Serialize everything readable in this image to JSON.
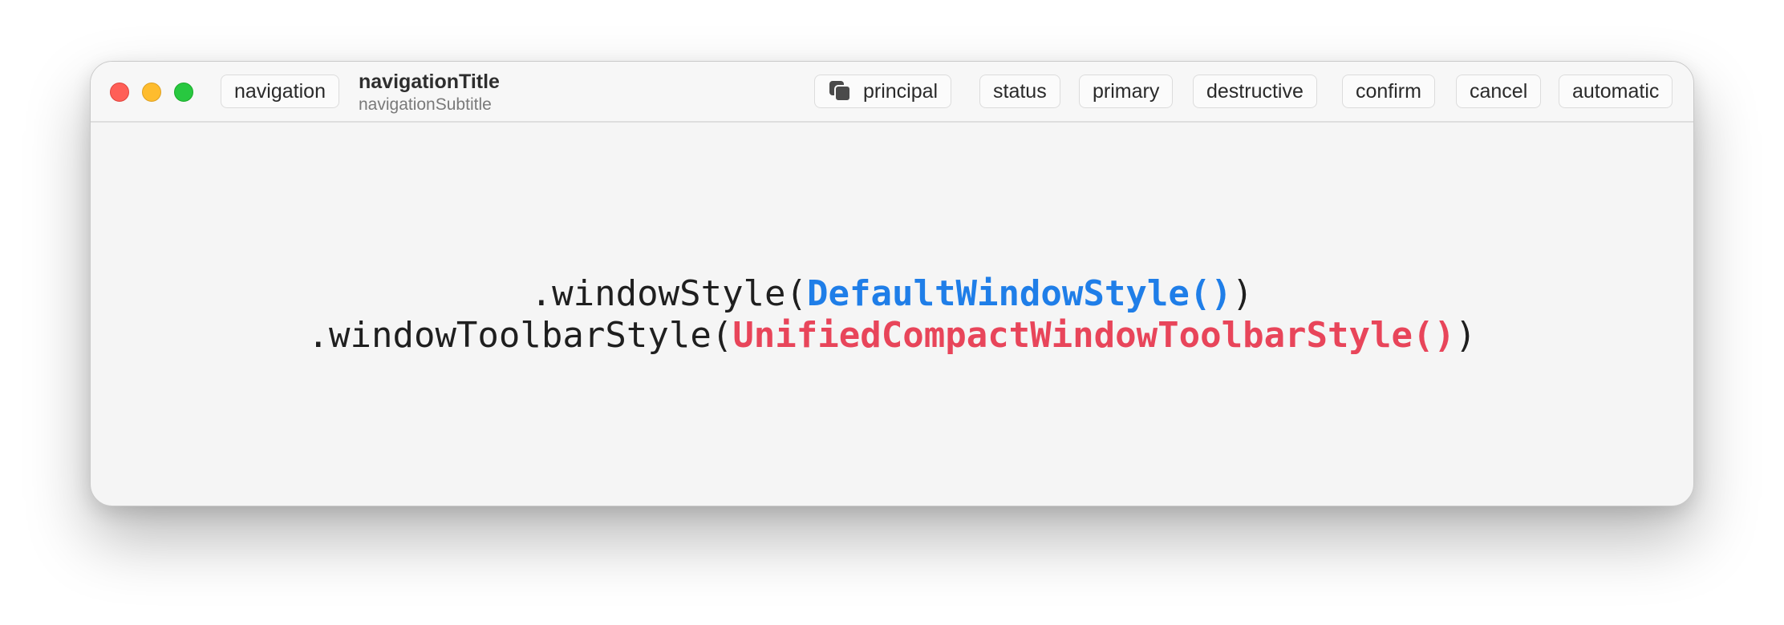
{
  "window": {
    "toolbar": {
      "navigation_label": "navigation",
      "title": "navigationTitle",
      "subtitle": "navigationSubtitle",
      "items": [
        {
          "label": "principal",
          "icon": "square-stack-icon"
        },
        {
          "label": "status"
        },
        {
          "label": "primary"
        },
        {
          "label": "destructive"
        },
        {
          "label": "confirm"
        },
        {
          "label": "cancel"
        },
        {
          "label": "automatic"
        }
      ]
    },
    "code": {
      "line1": {
        "prefix": ".windowStyle(",
        "highlight": "DefaultWindowStyle()",
        "suffix": ")"
      },
      "line2": {
        "prefix": ".windowToolbarStyle(",
        "highlight": "UnifiedCompactWindowToolbarStyle()",
        "suffix": ")"
      }
    },
    "colors": {
      "close": "#ff5f57",
      "minimize": "#febc2e",
      "zoom": "#28c840",
      "highlight_blue": "#1f7ee8",
      "highlight_red": "#e8455a"
    }
  }
}
